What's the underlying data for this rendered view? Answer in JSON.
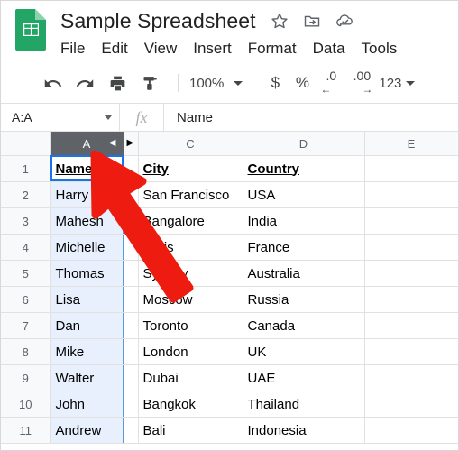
{
  "app": {
    "name": "google-sheets"
  },
  "header": {
    "logo_icon": "sheets-logo-icon",
    "doc_title": "Sample Spreadsheet",
    "title_icons": [
      {
        "name": "star-icon",
        "label": "Star"
      },
      {
        "name": "move-to-folder-icon",
        "label": "Move"
      },
      {
        "name": "cloud-saved-icon",
        "label": "Saved to Drive"
      }
    ],
    "menu": [
      {
        "label": "File"
      },
      {
        "label": "Edit"
      },
      {
        "label": "View"
      },
      {
        "label": "Insert"
      },
      {
        "label": "Format"
      },
      {
        "label": "Data"
      },
      {
        "label": "Tools"
      }
    ]
  },
  "toolbar": {
    "undo_icon": "undo-icon",
    "redo_icon": "redo-icon",
    "print_icon": "print-icon",
    "paint_format_icon": "paint-format-icon",
    "zoom_value": "100%",
    "currency_label": "$",
    "percent_label": "%",
    "decrease_decimal": {
      "num": ".0",
      "arrow": "←"
    },
    "increase_decimal": {
      "num": ".00",
      "arrow": "→"
    },
    "number_format_label": "123"
  },
  "formula_bar": {
    "name_box_value": "A:A",
    "fx_label": "fx",
    "formula_value": "Name"
  },
  "grid": {
    "columns": [
      {
        "label": "A",
        "selected": true,
        "arrow": "◀"
      },
      {
        "label": "",
        "hidden_marker": true,
        "arrow": "▶"
      },
      {
        "label": "C",
        "selected": false
      },
      {
        "label": "D",
        "selected": false
      },
      {
        "label": "E",
        "selected": false
      }
    ],
    "rows": [
      {
        "num": "1",
        "a": "Name",
        "c": "City",
        "d": "Country",
        "e": "",
        "header": true
      },
      {
        "num": "2",
        "a": "Harry",
        "c": "San Francisco",
        "d": "USA",
        "e": ""
      },
      {
        "num": "3",
        "a": "Mahesh",
        "c": "Bangalore",
        "d": "India",
        "e": ""
      },
      {
        "num": "4",
        "a": "Michelle",
        "c": "Paris",
        "d": "France",
        "e": ""
      },
      {
        "num": "5",
        "a": "Thomas",
        "c": "Sydney",
        "d": "Australia",
        "e": ""
      },
      {
        "num": "6",
        "a": "Lisa",
        "c": "Moscow",
        "d": "Russia",
        "e": ""
      },
      {
        "num": "7",
        "a": "Dan",
        "c": "Toronto",
        "d": "Canada",
        "e": ""
      },
      {
        "num": "8",
        "a": "Mike",
        "c": "London",
        "d": "UK",
        "e": ""
      },
      {
        "num": "9",
        "a": "Walter",
        "c": "Dubai",
        "d": "UAE",
        "e": ""
      },
      {
        "num": "10",
        "a": "John",
        "c": "Bangkok",
        "d": "Thailand",
        "e": ""
      },
      {
        "num": "11",
        "a": "Andrew",
        "c": "Bali",
        "d": "Indonesia",
        "e": ""
      }
    ]
  },
  "annotation": {
    "cursor_icon": "red-arrow-pointer",
    "color": "#ee1b11"
  },
  "colors": {
    "brand_green": "#23a566",
    "selection_blue": "#e8f0fe",
    "active_border": "#1a73e8",
    "header_gray": "#5f6368"
  }
}
